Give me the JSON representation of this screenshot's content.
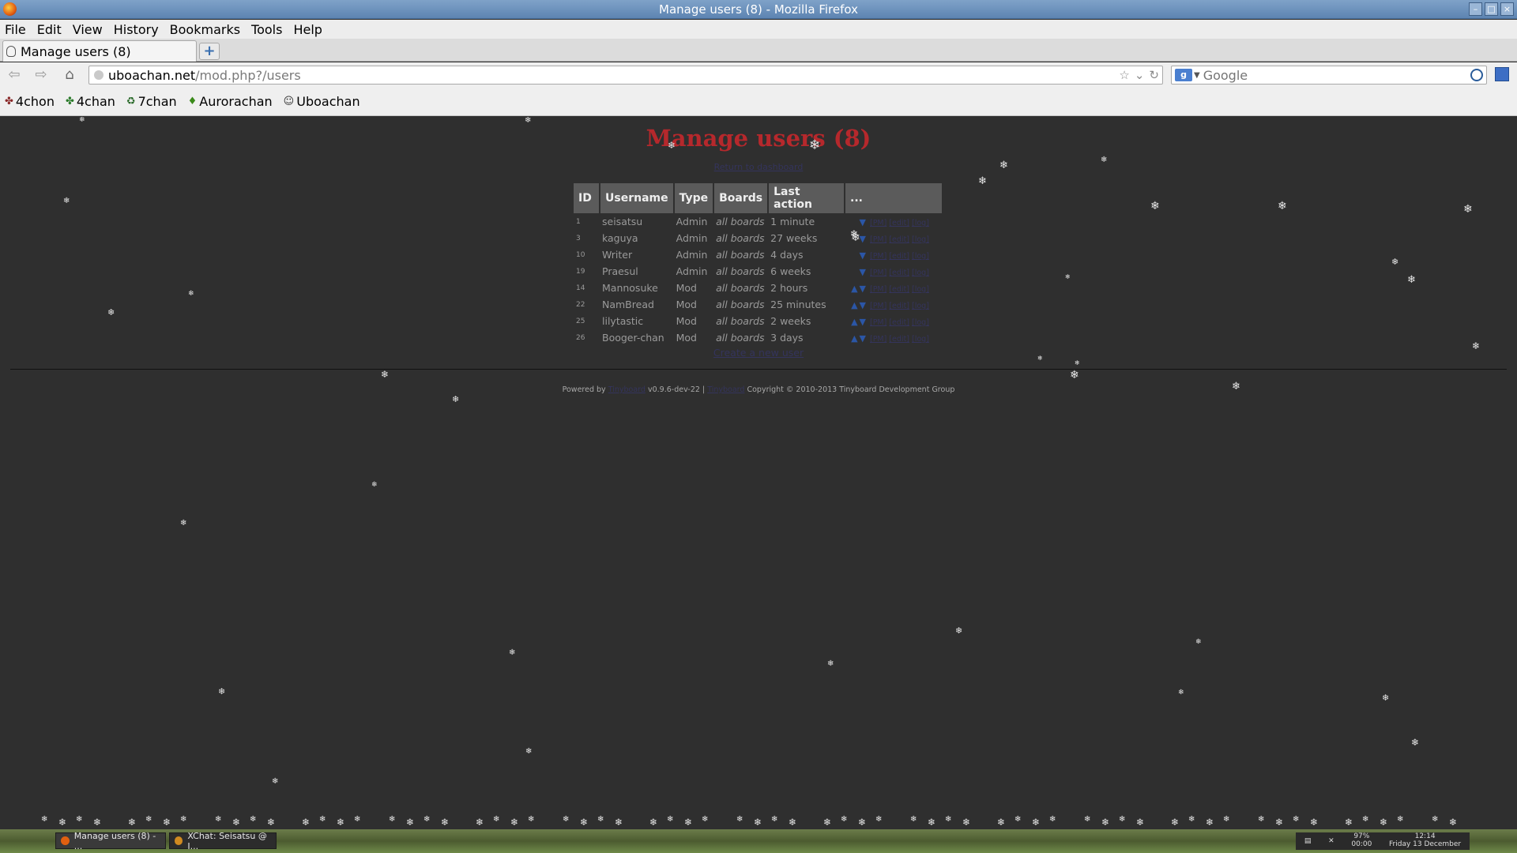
{
  "window": {
    "title": "Manage users (8) - Mozilla Firefox"
  },
  "menubar": [
    "File",
    "Edit",
    "View",
    "History",
    "Bookmarks",
    "Tools",
    "Help"
  ],
  "tab": {
    "label": "Manage users (8)",
    "new_tab_glyph": "+"
  },
  "nav": {
    "url_host": "uboachan.net",
    "url_path": "/mod.php?/users",
    "search_placeholder": "Google"
  },
  "bookmarks": [
    {
      "label": "4chon",
      "icon": "clover-icon",
      "color": "#8a2a2a"
    },
    {
      "label": "4chan",
      "icon": "clover-icon",
      "color": "#2a7a2a"
    },
    {
      "label": "7chan",
      "icon": "recycle-icon",
      "color": "#2a6a2a"
    },
    {
      "label": "Aurorachan",
      "icon": "leaf-icon",
      "color": "#3a8a1a"
    },
    {
      "label": "Uboachan",
      "icon": "face-icon",
      "color": "#333333"
    }
  ],
  "page": {
    "title": "Manage users (8)",
    "return_link": "Return to dashboard",
    "columns": [
      "ID",
      "Username",
      "Type",
      "Boards",
      "Last action",
      "..."
    ],
    "users": [
      {
        "id": "1",
        "username": "seisatsu",
        "type": "Admin",
        "boards": "all boards",
        "last_action": "1 minute",
        "up": "",
        "down": "▼"
      },
      {
        "id": "3",
        "username": "kaguya",
        "type": "Admin",
        "boards": "all boards",
        "last_action": "27 weeks",
        "up": "",
        "down": "▼"
      },
      {
        "id": "10",
        "username": "Writer",
        "type": "Admin",
        "boards": "all boards",
        "last_action": "4 days",
        "up": "",
        "down": "▼"
      },
      {
        "id": "19",
        "username": "Praesul",
        "type": "Admin",
        "boards": "all boards",
        "last_action": "6 weeks",
        "up": "",
        "down": "▼"
      },
      {
        "id": "14",
        "username": "Mannosuke",
        "type": "Mod",
        "boards": "all boards",
        "last_action": "2 hours",
        "up": "▲",
        "down": "▼"
      },
      {
        "id": "22",
        "username": "NamBread",
        "type": "Mod",
        "boards": "all boards",
        "last_action": "25 minutes",
        "up": "▲",
        "down": "▼"
      },
      {
        "id": "25",
        "username": "lilytastic",
        "type": "Mod",
        "boards": "all boards",
        "last_action": "2 weeks",
        "up": "▲",
        "down": "▼"
      },
      {
        "id": "26",
        "username": "Booger-chan",
        "type": "Mod",
        "boards": "all boards",
        "last_action": "3 days",
        "up": "▲",
        "down": "▼"
      }
    ],
    "row_actions": [
      "[PM]",
      "[edit]",
      "[log]"
    ],
    "create_link": "Create a new user",
    "footer": {
      "powered_by": "Powered by",
      "link1": "Tinyboard",
      "version": "v0.9.6-dev-22 |",
      "link2": "Tinyboard",
      "copyright": "Copyright © 2010-2013 Tinyboard Development Group"
    }
  },
  "taskbar": {
    "tasks": [
      {
        "label": "Manage users (8) - ...",
        "icon_color": "#e06010",
        "active": true
      },
      {
        "label": "XChat: Seisatsu @ I...",
        "icon_color": "#d08a20",
        "active": false
      }
    ],
    "battery": "97%",
    "battery_time": "00:00",
    "time": "12:14",
    "date": "Friday 13 December"
  }
}
